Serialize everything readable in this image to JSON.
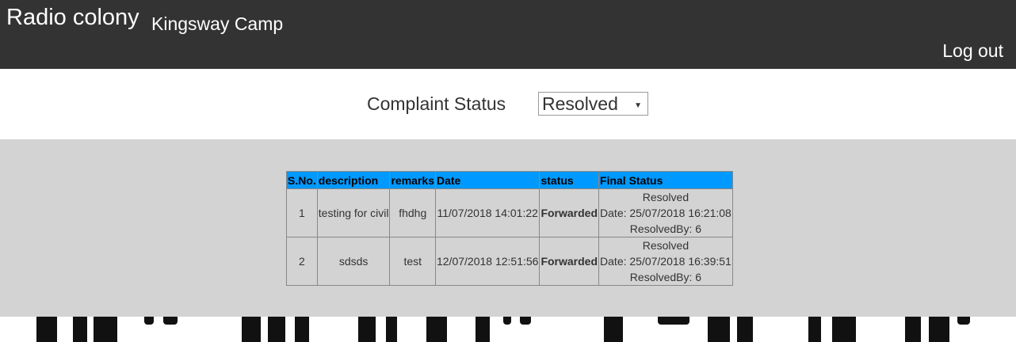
{
  "header": {
    "brand": "Radio colony",
    "subtitle": "Kingsway Camp",
    "logout_label": "Log out"
  },
  "filter": {
    "label": "Complaint Status",
    "selected": "Resolved"
  },
  "table": {
    "columns": [
      "S.No.",
      "description",
      "remarks",
      "Date",
      "status",
      "Final Status"
    ],
    "rows": [
      {
        "sno": "1",
        "description": "testing for civil",
        "remarks": "fhdhg",
        "date": "11/07/2018 14:01:22",
        "status": "Forwarded",
        "final_status": "Resolved",
        "final_date": "Date: 25/07/2018 16:21:08",
        "resolved_by": "ResolvedBy: 6"
      },
      {
        "sno": "2",
        "description": "sdsds",
        "remarks": "test",
        "date": "12/07/2018 12:51:56",
        "status": "Forwarded",
        "final_status": "Resolved",
        "final_date": "Date: 25/07/2018 16:39:51",
        "resolved_by": "ResolvedBy: 6"
      }
    ]
  },
  "colors": {
    "header_bg": "#333333",
    "table_header_bg": "#0099ff",
    "content_bg": "#d3d3d3"
  }
}
